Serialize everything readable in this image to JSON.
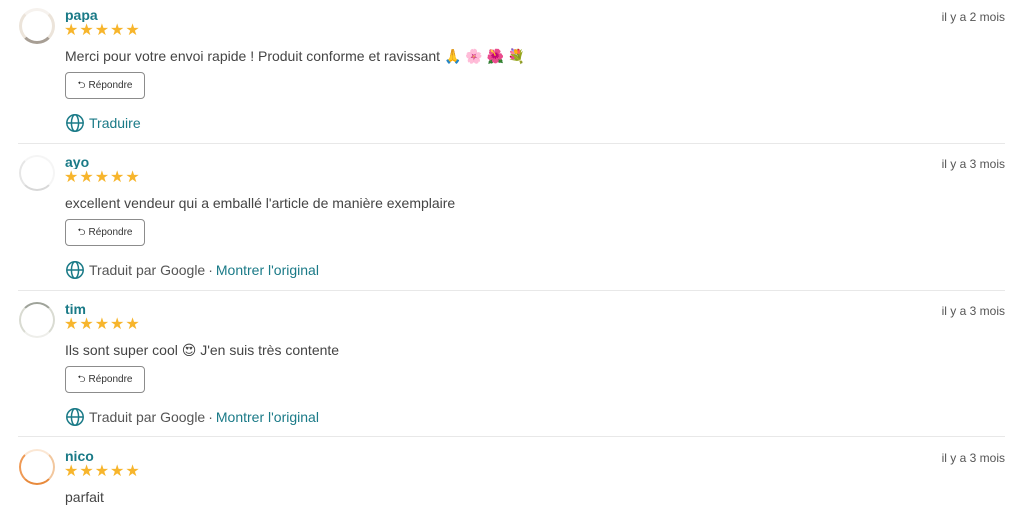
{
  "colors": {
    "accent": "#1a7a87",
    "star": "#f7b52c",
    "divider": "#e8e8e8"
  },
  "icons": {
    "star": "star-icon",
    "reply": "reply-arrow-icon",
    "globe": "globe-icon"
  },
  "reviews": [
    {
      "author": "papa",
      "rating": 5,
      "stars": "★★★★★",
      "date": "il y a 2 mois",
      "comment": "Merci pour votre envoi rapide ! Produit conforme et ravissant 🙏 🌸 🌺 💐",
      "reply_label": "Répondre",
      "translate_label": "Traduire"
    },
    {
      "author": "ayo",
      "rating": 5,
      "stars": "★★★★★",
      "date": "il y a 3 mois",
      "comment": "excellent vendeur qui a emballé l'article de manière exemplaire",
      "reply_label": "Répondre",
      "translated_by": "Traduit par Google",
      "show_original": "Montrer l'original"
    },
    {
      "author": "tim",
      "rating": 5,
      "stars": "★★★★★",
      "date": "il y a 3 mois",
      "comment": "Ils sont super cool 😍 J'en suis très contente",
      "reply_label": "Répondre",
      "translated_by": "Traduit par Google",
      "show_original": "Montrer l'original"
    },
    {
      "author": "nico",
      "rating": 5,
      "stars": "★★★★★",
      "date": "il y a 3 mois",
      "comment": "parfait"
    }
  ]
}
